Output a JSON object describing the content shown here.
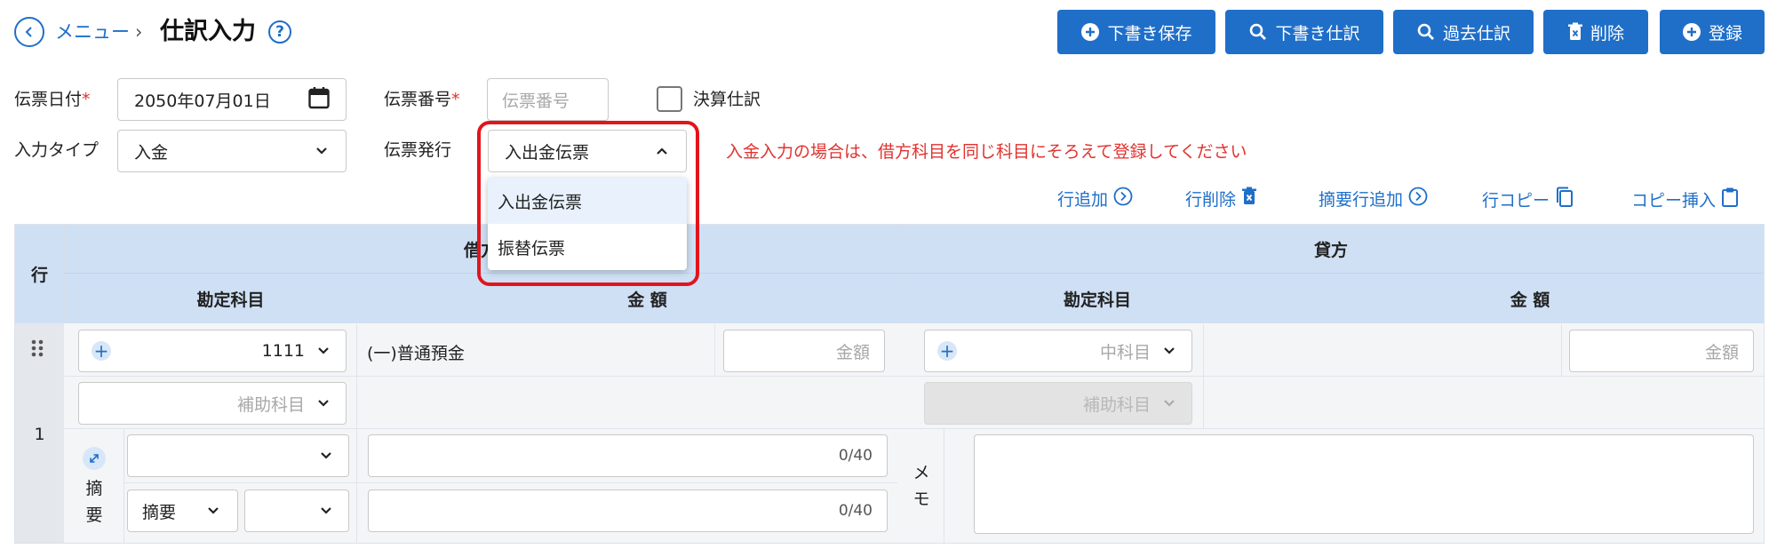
{
  "header": {
    "breadcrumb": "メニュー",
    "separator": "›",
    "title": "仕訳入力",
    "help": "?"
  },
  "toolbar": {
    "draft_save": "下書き保存",
    "draft_entries": "下書き仕訳",
    "past_entries": "過去仕訳",
    "delete": "削除",
    "register": "登録"
  },
  "form": {
    "slip_date_label": "伝票日付",
    "slip_date_value": "2050年07月01日",
    "slip_number_label": "伝票番号",
    "slip_number_placeholder": "伝票番号",
    "closing_label": "決算仕訳",
    "input_type_label": "入力タイプ",
    "input_type_value": "入金",
    "slip_issue_label": "伝票発行",
    "slip_issue_value": "入出金伝票",
    "required_mark": "*",
    "warning": "入金入力の場合は、借方科目を同じ科目にそろえて登録してください"
  },
  "dropdown": {
    "options": [
      "入出金伝票",
      "振替伝票"
    ],
    "selected": "入出金伝票"
  },
  "actions": {
    "add_row": "行追加",
    "delete_row": "行削除",
    "add_summary_row": "摘要行追加",
    "copy_row": "行コピー",
    "copy_insert": "コピー挿入"
  },
  "table": {
    "row_header": "行",
    "debit_header": "借方",
    "credit_header": "貸方",
    "account_header": "勘定科目",
    "amount_header": "金 額",
    "row_number": "1",
    "debit_account_code": "1111",
    "debit_account_name": "(一)普通預金",
    "amount_placeholder": "金額",
    "sub_account_placeholder": "補助科目",
    "mid_account_placeholder": "中科目",
    "summary_label": "摘要",
    "summary_select": "摘要",
    "counter_1": "0/40",
    "counter_2": "0/40",
    "memo_label": "メモ",
    "summary_vertical": [
      "摘",
      "要"
    ],
    "memo_vertical": [
      "メ",
      "モ"
    ]
  },
  "colors": {
    "primary": "#1f6fc9",
    "header_bg": "#cfe0f5",
    "warning": "#e0332f",
    "highlight": "#e2141c"
  }
}
